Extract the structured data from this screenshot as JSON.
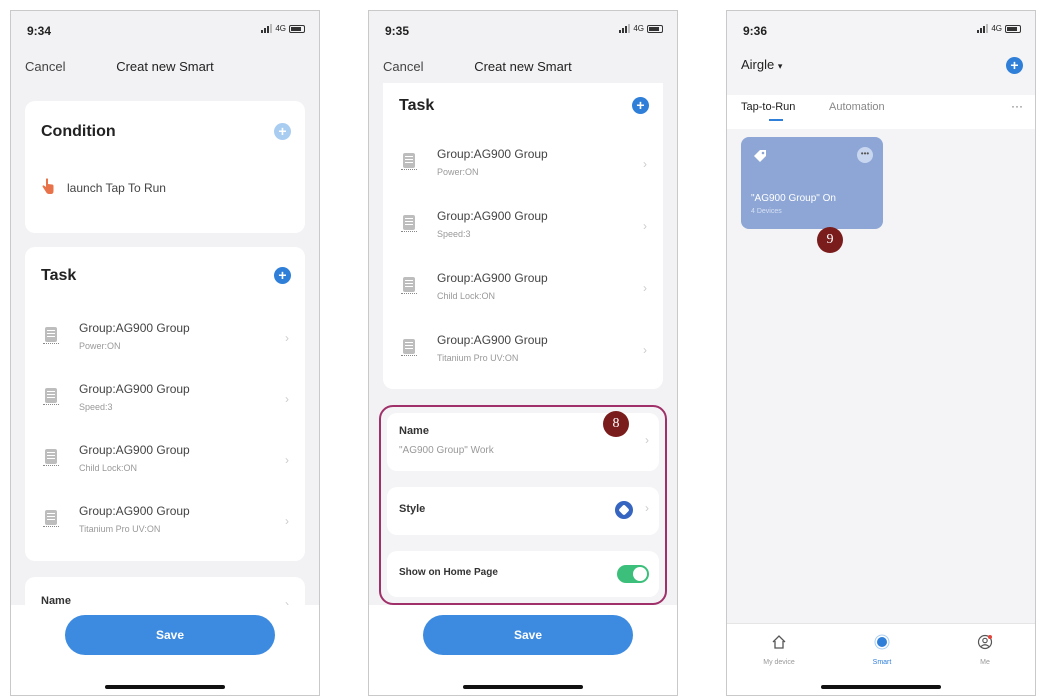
{
  "screen1": {
    "time": "9:34",
    "network": "4G",
    "cancel": "Cancel",
    "title": "Creat new Smart",
    "condition": {
      "title": "Condition",
      "item": "launch Tap To Run"
    },
    "task": {
      "title": "Task",
      "items": [
        {
          "name": "Group:AG900 Group",
          "sub": "Power:ON"
        },
        {
          "name": "Group:AG900 Group",
          "sub": "Speed:3"
        },
        {
          "name": "Group:AG900 Group",
          "sub": "Child Lock:ON"
        },
        {
          "name": "Group:AG900 Group",
          "sub": "Titanium Pro UV:ON"
        }
      ]
    },
    "name_label": "Name",
    "save": "Save"
  },
  "screen2": {
    "time": "9:35",
    "network": "4G",
    "cancel": "Cancel",
    "title": "Creat new Smart",
    "task": {
      "title": "Task",
      "items": [
        {
          "name": "Group:AG900 Group",
          "sub": "Power:ON"
        },
        {
          "name": "Group:AG900 Group",
          "sub": "Speed:3"
        },
        {
          "name": "Group:AG900 Group",
          "sub": "Child Lock:ON"
        },
        {
          "name": "Group:AG900 Group",
          "sub": "Titanium Pro UV:ON"
        }
      ]
    },
    "name": {
      "label": "Name",
      "value": "\"AG900 Group\" Work"
    },
    "style_label": "Style",
    "show_home": {
      "label": "Show on Home Page",
      "enabled": true
    },
    "badge": "8",
    "save": "Save"
  },
  "screen3": {
    "time": "9:36",
    "network": "4G",
    "home_name": "Airgle",
    "tabs": [
      "Tap-to-Run",
      "Automation"
    ],
    "more": "···",
    "scene": {
      "name": "\"AG900 Group\" On",
      "sub": "4 Devices"
    },
    "badge": "9",
    "tabbar": [
      "My device",
      "Smart",
      "Me"
    ]
  },
  "colors": {
    "accent": "#2f7fd9",
    "save_button": "#3d8be0",
    "highlight_border": "#a0306a",
    "badge": "#7a1c1c",
    "toggle_on": "#3bbf7a",
    "scene_card": "#8da6d6"
  }
}
